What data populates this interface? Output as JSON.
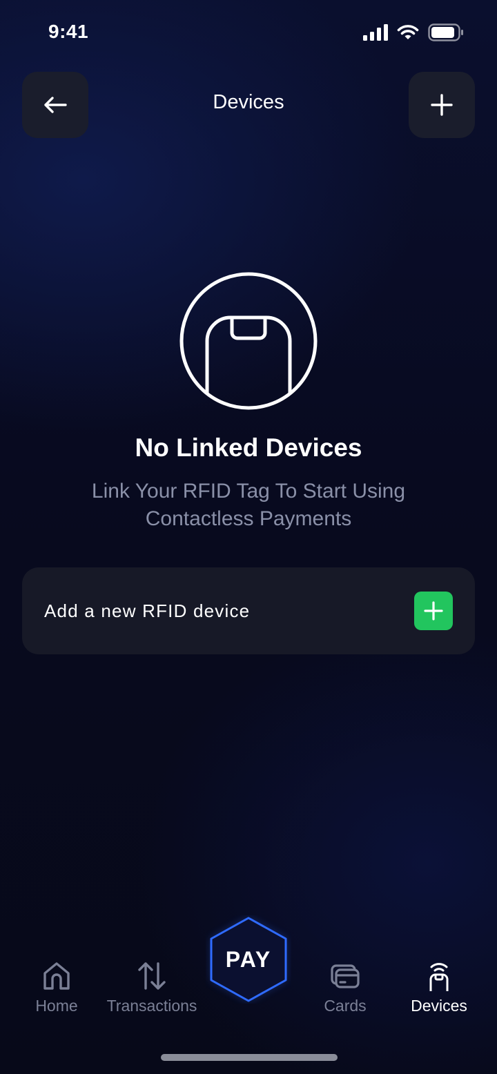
{
  "status_bar": {
    "time": "9:41"
  },
  "header": {
    "title": "Devices"
  },
  "empty_state": {
    "title": "No Linked Devices",
    "line1": "Link Your RFID Tag To Start Using",
    "line2": "Contactless Payments"
  },
  "add_device": {
    "label": "Add a new RFID device"
  },
  "nav": {
    "home": "Home",
    "transactions": "Transactions",
    "pay": "PAY",
    "cards": "Cards",
    "devices": "Devices"
  },
  "colors": {
    "accent_green": "#22c55e",
    "pay_ring": "#2f6bff",
    "muted_text": "#8a90a8"
  }
}
